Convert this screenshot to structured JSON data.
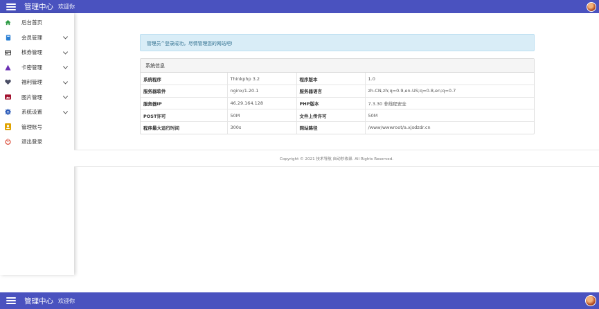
{
  "header": {
    "title": "管理中心",
    "welcome": "欢迎你"
  },
  "sidebar": {
    "items": [
      {
        "label": "后台首页",
        "icon": "home-icon",
        "color": "#2e9b45",
        "expandable": false
      },
      {
        "label": "会员管理",
        "icon": "book-icon",
        "color": "#2a7fd4",
        "expandable": true
      },
      {
        "label": "核券管理",
        "icon": "card-icon",
        "color": "#333333",
        "expandable": true
      },
      {
        "label": "卡密管理",
        "icon": "triangle-icon",
        "color": "#6a2fb3",
        "expandable": true
      },
      {
        "label": "福利管理",
        "icon": "heart-icon",
        "color": "#4b4f66",
        "expandable": true
      },
      {
        "label": "图片管理",
        "icon": "image-icon",
        "color": "#a2122f",
        "expandable": true
      },
      {
        "label": "系统设置",
        "icon": "gear-icon",
        "color": "#2a5ab8",
        "expandable": true
      },
      {
        "label": "管理账号",
        "icon": "user-card-icon",
        "color": "#e0a300",
        "expandable": false
      },
      {
        "label": "退出登录",
        "icon": "power-icon",
        "color": "#d9402b",
        "expandable": false
      }
    ]
  },
  "alert": {
    "text": "管理员^登录成功，尽情管理您的网站吧!"
  },
  "system_info": {
    "title": "系统信息",
    "rows": [
      {
        "k1": "系统程序",
        "v1": "Thinkphp 3.2",
        "k2": "程序版本",
        "v2": "1.0"
      },
      {
        "k1": "服务器软件",
        "v1": "nginx/1.20.1",
        "k2": "服务器语言",
        "v2": "zh-CN,zh;q=0.9,en-US;q=0.8,en;q=0.7"
      },
      {
        "k1": "服务器IP",
        "v1": "46.29.164.128",
        "k2": "PHP版本",
        "v2": "7.3.30 非线程安全"
      },
      {
        "k1": "POST许可",
        "v1": "50M",
        "k2": "文件上传许可",
        "v2": "50M"
      },
      {
        "k1": "程序最大运行时间",
        "v1": "300s",
        "k2": "网站路径",
        "v2": "/www/wwwroot/a.xjsdzdr.cn"
      }
    ]
  },
  "footer": {
    "text": "Copyright © 2021 技术导航 自动秒收录. All Rights Reserved."
  },
  "colors": {
    "topbar": "#4a52bf",
    "alert_bg": "#d9edf7"
  }
}
